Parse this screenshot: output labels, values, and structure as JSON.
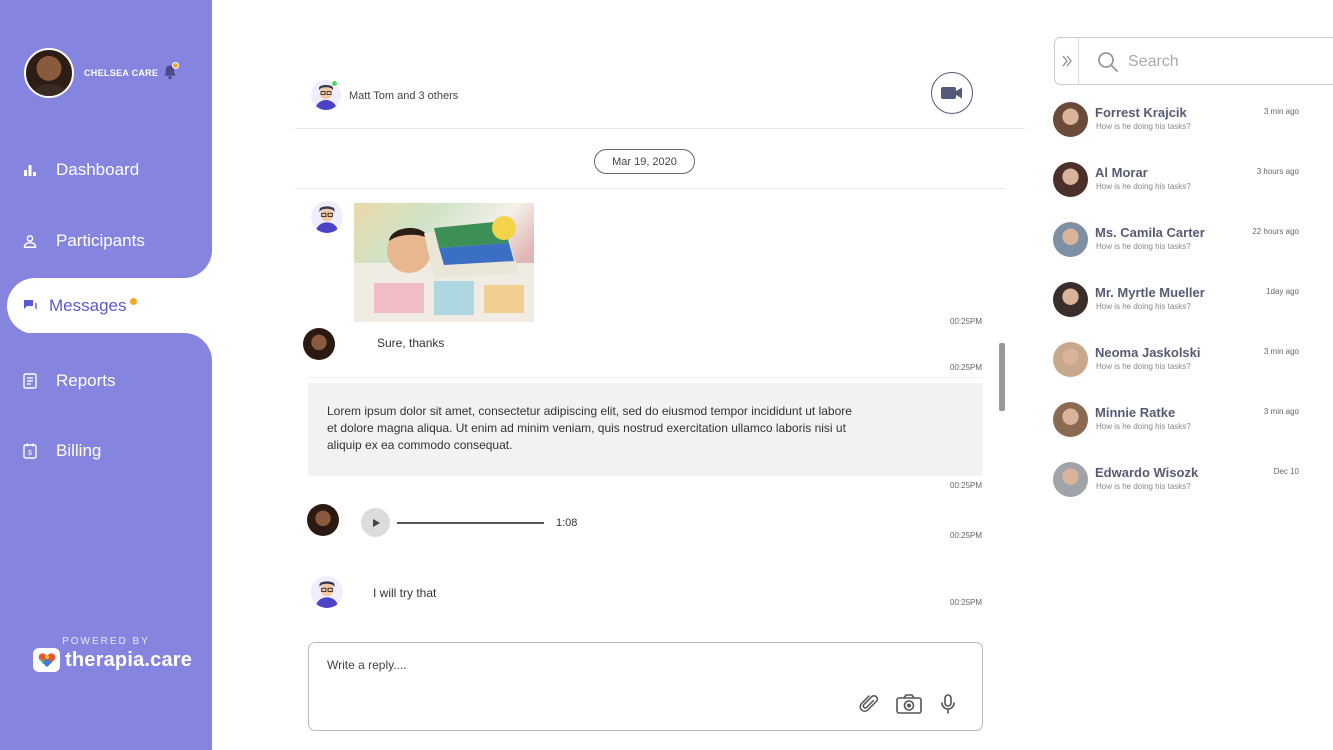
{
  "user": {
    "name": "CHELSEA CARE"
  },
  "nav": {
    "items": [
      {
        "label": "Dashboard",
        "icon": "bar-chart-icon"
      },
      {
        "label": "Participants",
        "icon": "person-icon"
      },
      {
        "label": "Messages",
        "icon": "chat-icon",
        "active": true
      },
      {
        "label": "Reports",
        "icon": "document-icon"
      },
      {
        "label": "Billing",
        "icon": "invoice-icon"
      }
    ]
  },
  "footer": {
    "powered_by": "POWERED BY",
    "brand": "therapia.care"
  },
  "chat": {
    "header_title": "Matt Tom and 3 others",
    "date": "Mar 19, 2020",
    "messages": [
      {
        "type": "image",
        "time": "00:25PM"
      },
      {
        "type": "text",
        "text": "Sure, thanks",
        "time": "00:25PM"
      },
      {
        "type": "long",
        "text": "Lorem ipsum dolor sit amet, consectetur adipiscing elit, sed do eiusmod tempor incididunt ut labore et dolore magna aliqua. Ut enim ad minim veniam, quis nostrud exercitation ullamco laboris nisi ut aliquip ex ea commodo consequat.",
        "time": "00:25PM"
      },
      {
        "type": "audio",
        "duration": "1:08",
        "time": "00:25PM"
      },
      {
        "type": "text",
        "text": "I will try that",
        "time": "00:25PM"
      }
    ],
    "reply_placeholder": "Write a reply...."
  },
  "search": {
    "placeholder": "Search"
  },
  "contacts": [
    {
      "name": "Forrest Krajcik",
      "message": "How is he doing his tasks?",
      "time": "3 min ago"
    },
    {
      "name": "Al Morar",
      "message": "How is he doing his tasks?",
      "time": "3 hours ago"
    },
    {
      "name": "Ms. Camila Carter",
      "message": "How is he doing his tasks?",
      "time": "22 hours ago"
    },
    {
      "name": "Mr. Myrtle Mueller",
      "message": "How is he doing his tasks?",
      "time": "1day ago"
    },
    {
      "name": "Neoma Jaskolski",
      "message": "How is he doing his tasks?",
      "time": "3 min ago"
    },
    {
      "name": "Minnie Ratke",
      "message": "How is he doing his tasks?",
      "time": "3 min ago"
    },
    {
      "name": "Edwardo Wisozk",
      "message": "How is he doing his tasks?",
      "time": "Dec 10"
    }
  ],
  "colors": {
    "sidebar": "#8585e0",
    "accent": "#5a5ad0",
    "notification": "#f5a623",
    "online": "#4cd964"
  }
}
